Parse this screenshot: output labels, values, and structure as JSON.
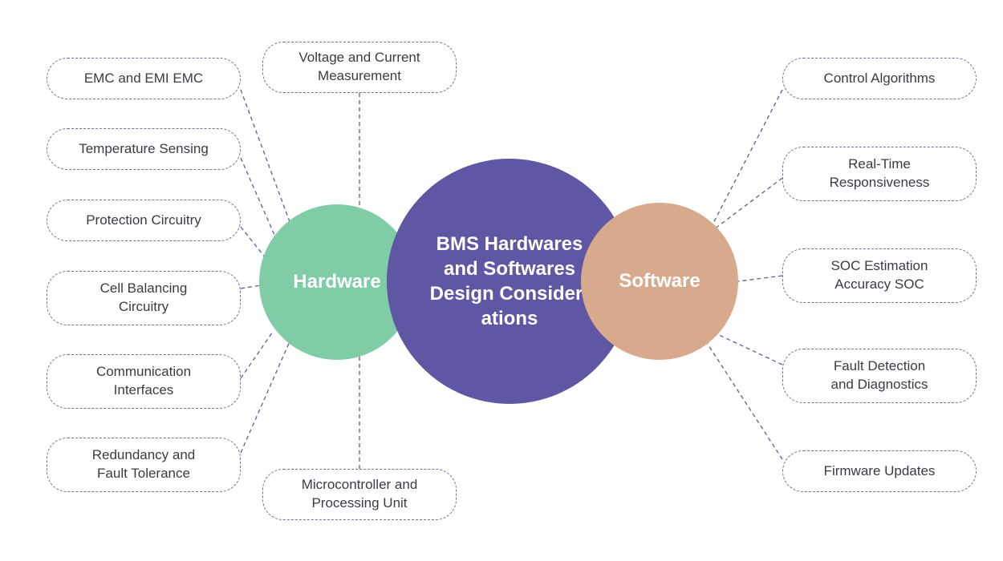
{
  "diagram": {
    "title": "BMS Hardwares and Softwares Design Considerations",
    "colors": {
      "center_circle": "#5F57A3",
      "hardware_circle": "#7FCCA6",
      "software_circle": "#D8AA8D",
      "node_border": "#6f72a0",
      "node_text": "#3b3b44",
      "connector": "#5a5f96",
      "background": "#ffffff"
    },
    "center": {
      "label": "BMS Hardwares and Softwares Design Consider-ations",
      "line1": "BMS Hardwares",
      "line2": "and Softwares",
      "line3": "Design Consider-",
      "line4": "ations"
    },
    "branches": [
      {
        "id": "hardware",
        "label": "Hardware"
      },
      {
        "id": "software",
        "label": "Software"
      }
    ],
    "hardware_nodes": [
      {
        "id": "emc-and-emi-emc",
        "line1": "EMC and EMI EMC",
        "line2": ""
      },
      {
        "id": "temperature-sensing",
        "line1": "Temperature Sensing",
        "line2": ""
      },
      {
        "id": "protection-circuitry",
        "line1": "Protection Circuitry",
        "line2": ""
      },
      {
        "id": "cell-balancing-circuitry",
        "line1": "Cell Balancing",
        "line2": "Circuitry"
      },
      {
        "id": "communication-interfaces",
        "line1": "Communication",
        "line2": "Interfaces"
      },
      {
        "id": "redundancy-and-fault-tolerance",
        "line1": "Redundancy and",
        "line2": "Fault Tolerance"
      },
      {
        "id": "voltage-and-current-measurement",
        "line1": "Voltage and Current",
        "line2": "Measurement"
      },
      {
        "id": "microcontroller-and-processing-unit",
        "line1": "Microcontroller and",
        "line2": "Processing Unit"
      }
    ],
    "software_nodes": [
      {
        "id": "control-algorithms",
        "line1": "Control Algorithms",
        "line2": ""
      },
      {
        "id": "real-time-responsiveness",
        "line1": "Real-Time",
        "line2": "Responsiveness"
      },
      {
        "id": "soc-estimation-accuracy-soc",
        "line1": "SOC Estimation",
        "line2": "Accuracy SOC"
      },
      {
        "id": "fault-detection-and-diagnostics",
        "line1": "Fault Detection",
        "line2": "and Diagnostics"
      },
      {
        "id": "firmware-updates",
        "line1": "Firmware Updates",
        "line2": ""
      }
    ]
  }
}
